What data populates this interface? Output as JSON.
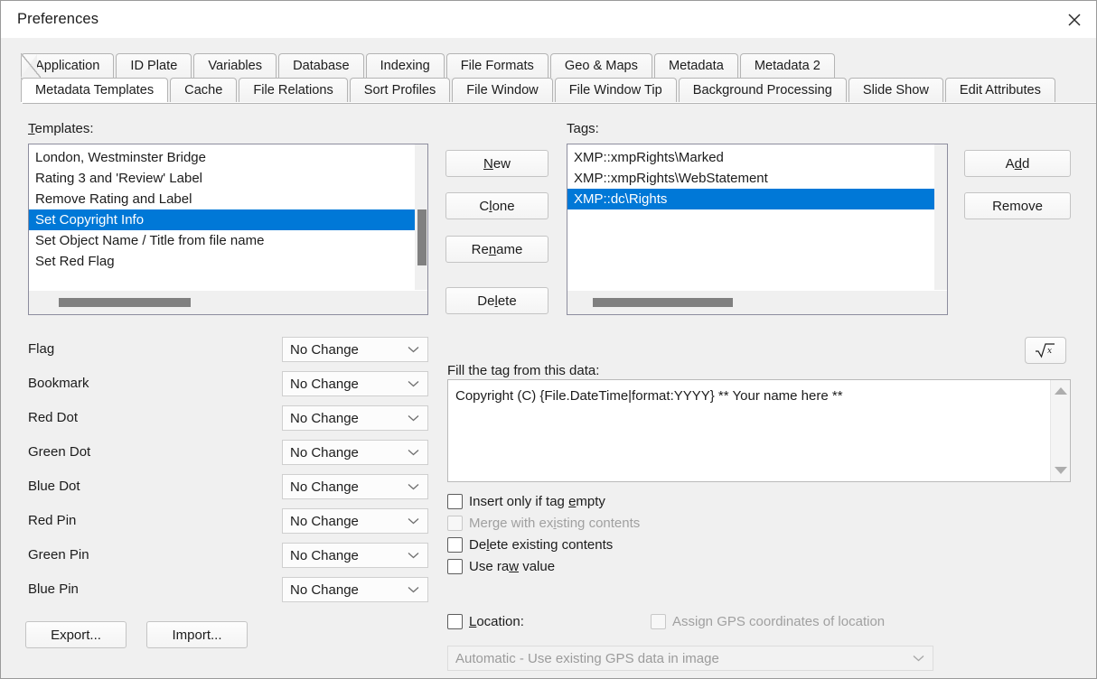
{
  "window": {
    "title": "Preferences",
    "close_icon": "close-icon"
  },
  "tabs": {
    "row1": [
      {
        "label": "Application",
        "active": false
      },
      {
        "label": "ID Plate",
        "active": false
      },
      {
        "label": "Variables",
        "active": false
      },
      {
        "label": "Database",
        "active": false
      },
      {
        "label": "Indexing",
        "active": false
      },
      {
        "label": "File Formats",
        "active": false
      },
      {
        "label": "Geo & Maps",
        "active": false
      },
      {
        "label": "Metadata",
        "active": false
      },
      {
        "label": "Metadata 2",
        "active": false
      }
    ],
    "row2": [
      {
        "label": "Metadata Templates",
        "active": true
      },
      {
        "label": "Cache",
        "active": false
      },
      {
        "label": "File Relations",
        "active": false
      },
      {
        "label": "Sort Profiles",
        "active": false
      },
      {
        "label": "File Window",
        "active": false
      },
      {
        "label": "File Window Tip",
        "active": false
      },
      {
        "label": "Background Processing",
        "active": false
      },
      {
        "label": "Slide Show",
        "active": false
      },
      {
        "label": "Edit Attributes",
        "active": false
      }
    ]
  },
  "templates": {
    "label": "Templates:",
    "label_accel": "T",
    "items": [
      "London, Westminster Bridge",
      "Rating 3 and 'Review' Label",
      "Remove Rating and Label",
      "Set Copyright Info",
      "Set Object Name / Title from file name",
      "Set Red Flag"
    ],
    "selected_index": 3
  },
  "template_buttons": [
    {
      "label": "New",
      "accel": "N"
    },
    {
      "label": "Clone",
      "accel": "l"
    },
    {
      "label": "Rename",
      "accel": "n"
    },
    {
      "label": "Delete",
      "accel": "l"
    }
  ],
  "tags": {
    "label": "Tags:",
    "items": [
      "XMP::xmpRights\\Marked",
      "XMP::xmpRights\\WebStatement",
      "XMP::dc\\Rights"
    ],
    "selected_index": 2
  },
  "tag_buttons": [
    {
      "label": "Add",
      "accel": "d"
    },
    {
      "label": "Remove",
      "accel": ""
    }
  ],
  "attributes": {
    "rows": [
      {
        "label": "Flag",
        "value": "No Change"
      },
      {
        "label": "Bookmark",
        "value": "No Change"
      },
      {
        "label": "Red Dot",
        "value": "No Change"
      },
      {
        "label": "Green Dot",
        "value": "No Change"
      },
      {
        "label": "Blue Dot",
        "value": "No Change"
      },
      {
        "label": "Red Pin",
        "value": "No Change"
      },
      {
        "label": "Green Pin",
        "value": "No Change"
      },
      {
        "label": "Blue Pin",
        "value": "No Change"
      }
    ]
  },
  "footer_buttons": [
    {
      "label": "Export..."
    },
    {
      "label": "Import..."
    }
  ],
  "fill_section": {
    "label": "Fill the tag from this data:",
    "value": "Copyright (C) {File.DateTime|format:YYYY} ** Your name here **",
    "formula_button_label": "√x"
  },
  "options": [
    {
      "label_pre": "Insert only if tag ",
      "accel": "e",
      "label_post": "mpty",
      "checked": false,
      "disabled": false
    },
    {
      "label_pre": "Merge with ex",
      "accel": "i",
      "label_post": "sting contents",
      "checked": false,
      "disabled": true
    },
    {
      "label_pre": "De",
      "accel": "l",
      "label_post": "ete existing contents",
      "checked": false,
      "disabled": false
    },
    {
      "label_pre": "Use ra",
      "accel": "w",
      "label_post": " value",
      "checked": false,
      "disabled": false
    }
  ],
  "location": {
    "label_pre": "L",
    "accel": "o",
    "label_post": "cation:",
    "checked": false,
    "gps_checkbox_label": "Assign GPS coordinates of location",
    "gps_checked": false,
    "gps_mode": "Automatic -  Use existing GPS data in image"
  },
  "colors": {
    "selection_blue": "#0078d7",
    "window_bg": "#f0f0f0",
    "list_bg": "#ffffff",
    "scroll_thumb": "#808080",
    "text": "#1c1c1c",
    "disabled_text": "#a0a0a0"
  }
}
